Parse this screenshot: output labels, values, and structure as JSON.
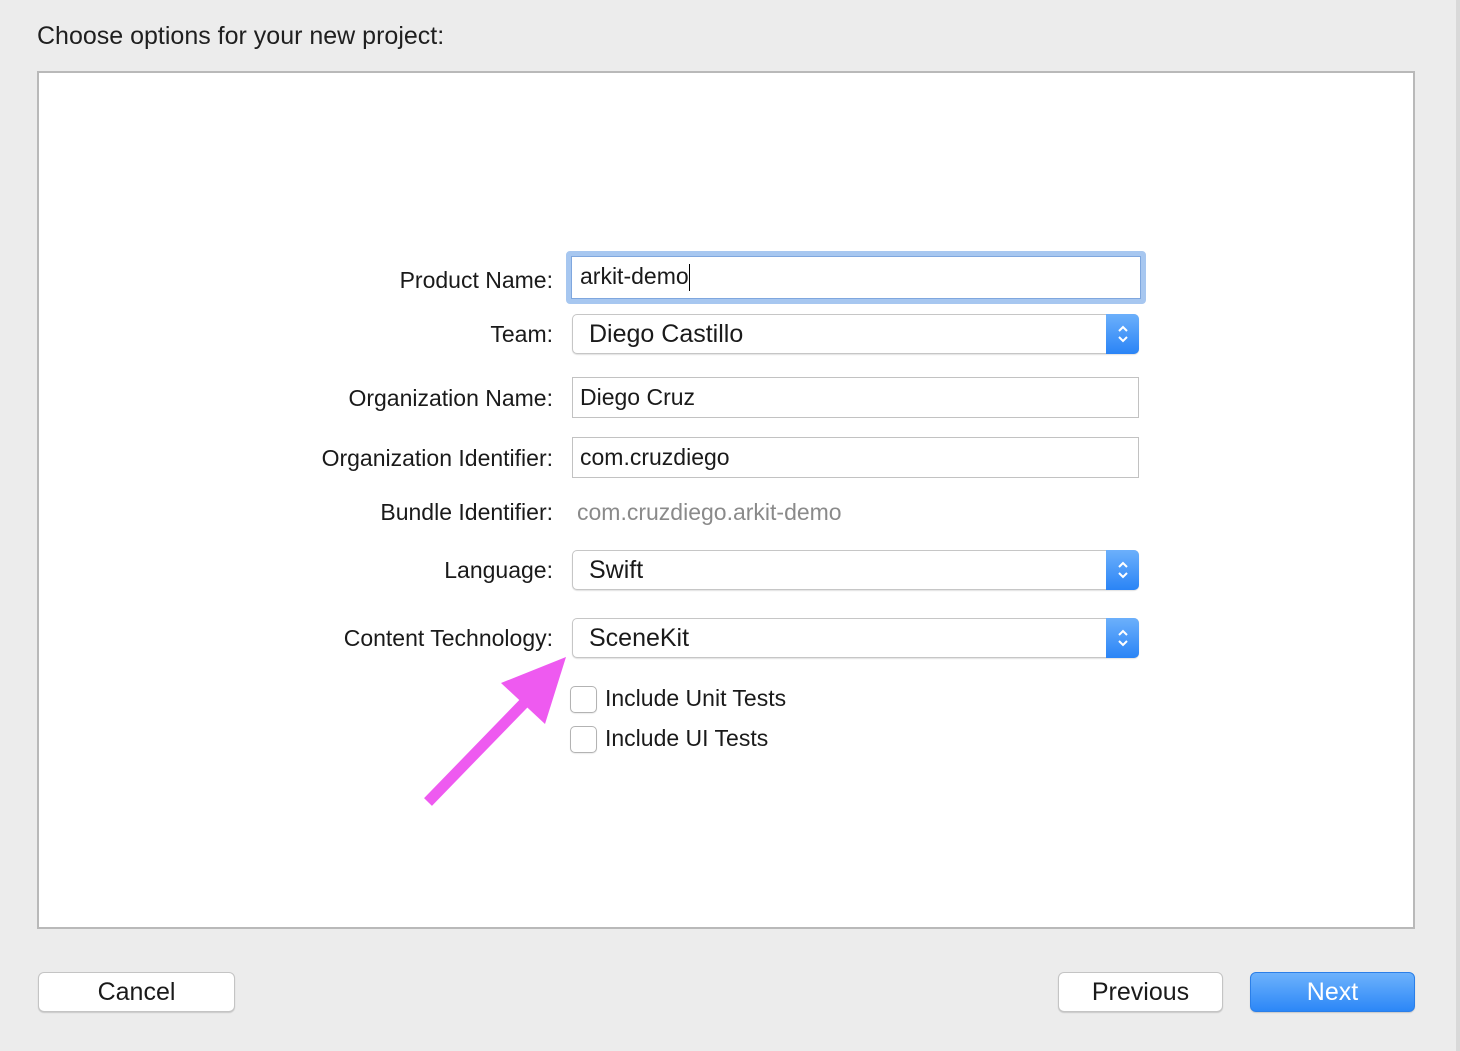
{
  "dialog": {
    "heading": "Choose options for your new project:"
  },
  "form": {
    "product_name": {
      "label": "Product Name:",
      "value": "arkit-demo"
    },
    "team": {
      "label": "Team:",
      "value": "Diego Castillo"
    },
    "organization_name": {
      "label": "Organization Name:",
      "value": "Diego Cruz"
    },
    "organization_identifier": {
      "label": "Organization Identifier:",
      "value": "com.cruzdiego"
    },
    "bundle_identifier": {
      "label": "Bundle Identifier:",
      "value": "com.cruzdiego.arkit-demo"
    },
    "language": {
      "label": "Language:",
      "value": "Swift"
    },
    "content_technology": {
      "label": "Content Technology:",
      "value": "SceneKit"
    },
    "include_unit_tests": {
      "label": "Include Unit Tests",
      "checked": false
    },
    "include_ui_tests": {
      "label": "Include UI Tests",
      "checked": false
    }
  },
  "buttons": {
    "cancel": "Cancel",
    "previous": "Previous",
    "next": "Next"
  },
  "colors": {
    "accent": "#2c87f7",
    "focus_ring": "#a7c7f0",
    "annotation_arrow": "#ee5af0"
  },
  "icons": {
    "popup_stepper": "chevron-up-down-icon",
    "annotation": "arrow-annotation-icon"
  }
}
